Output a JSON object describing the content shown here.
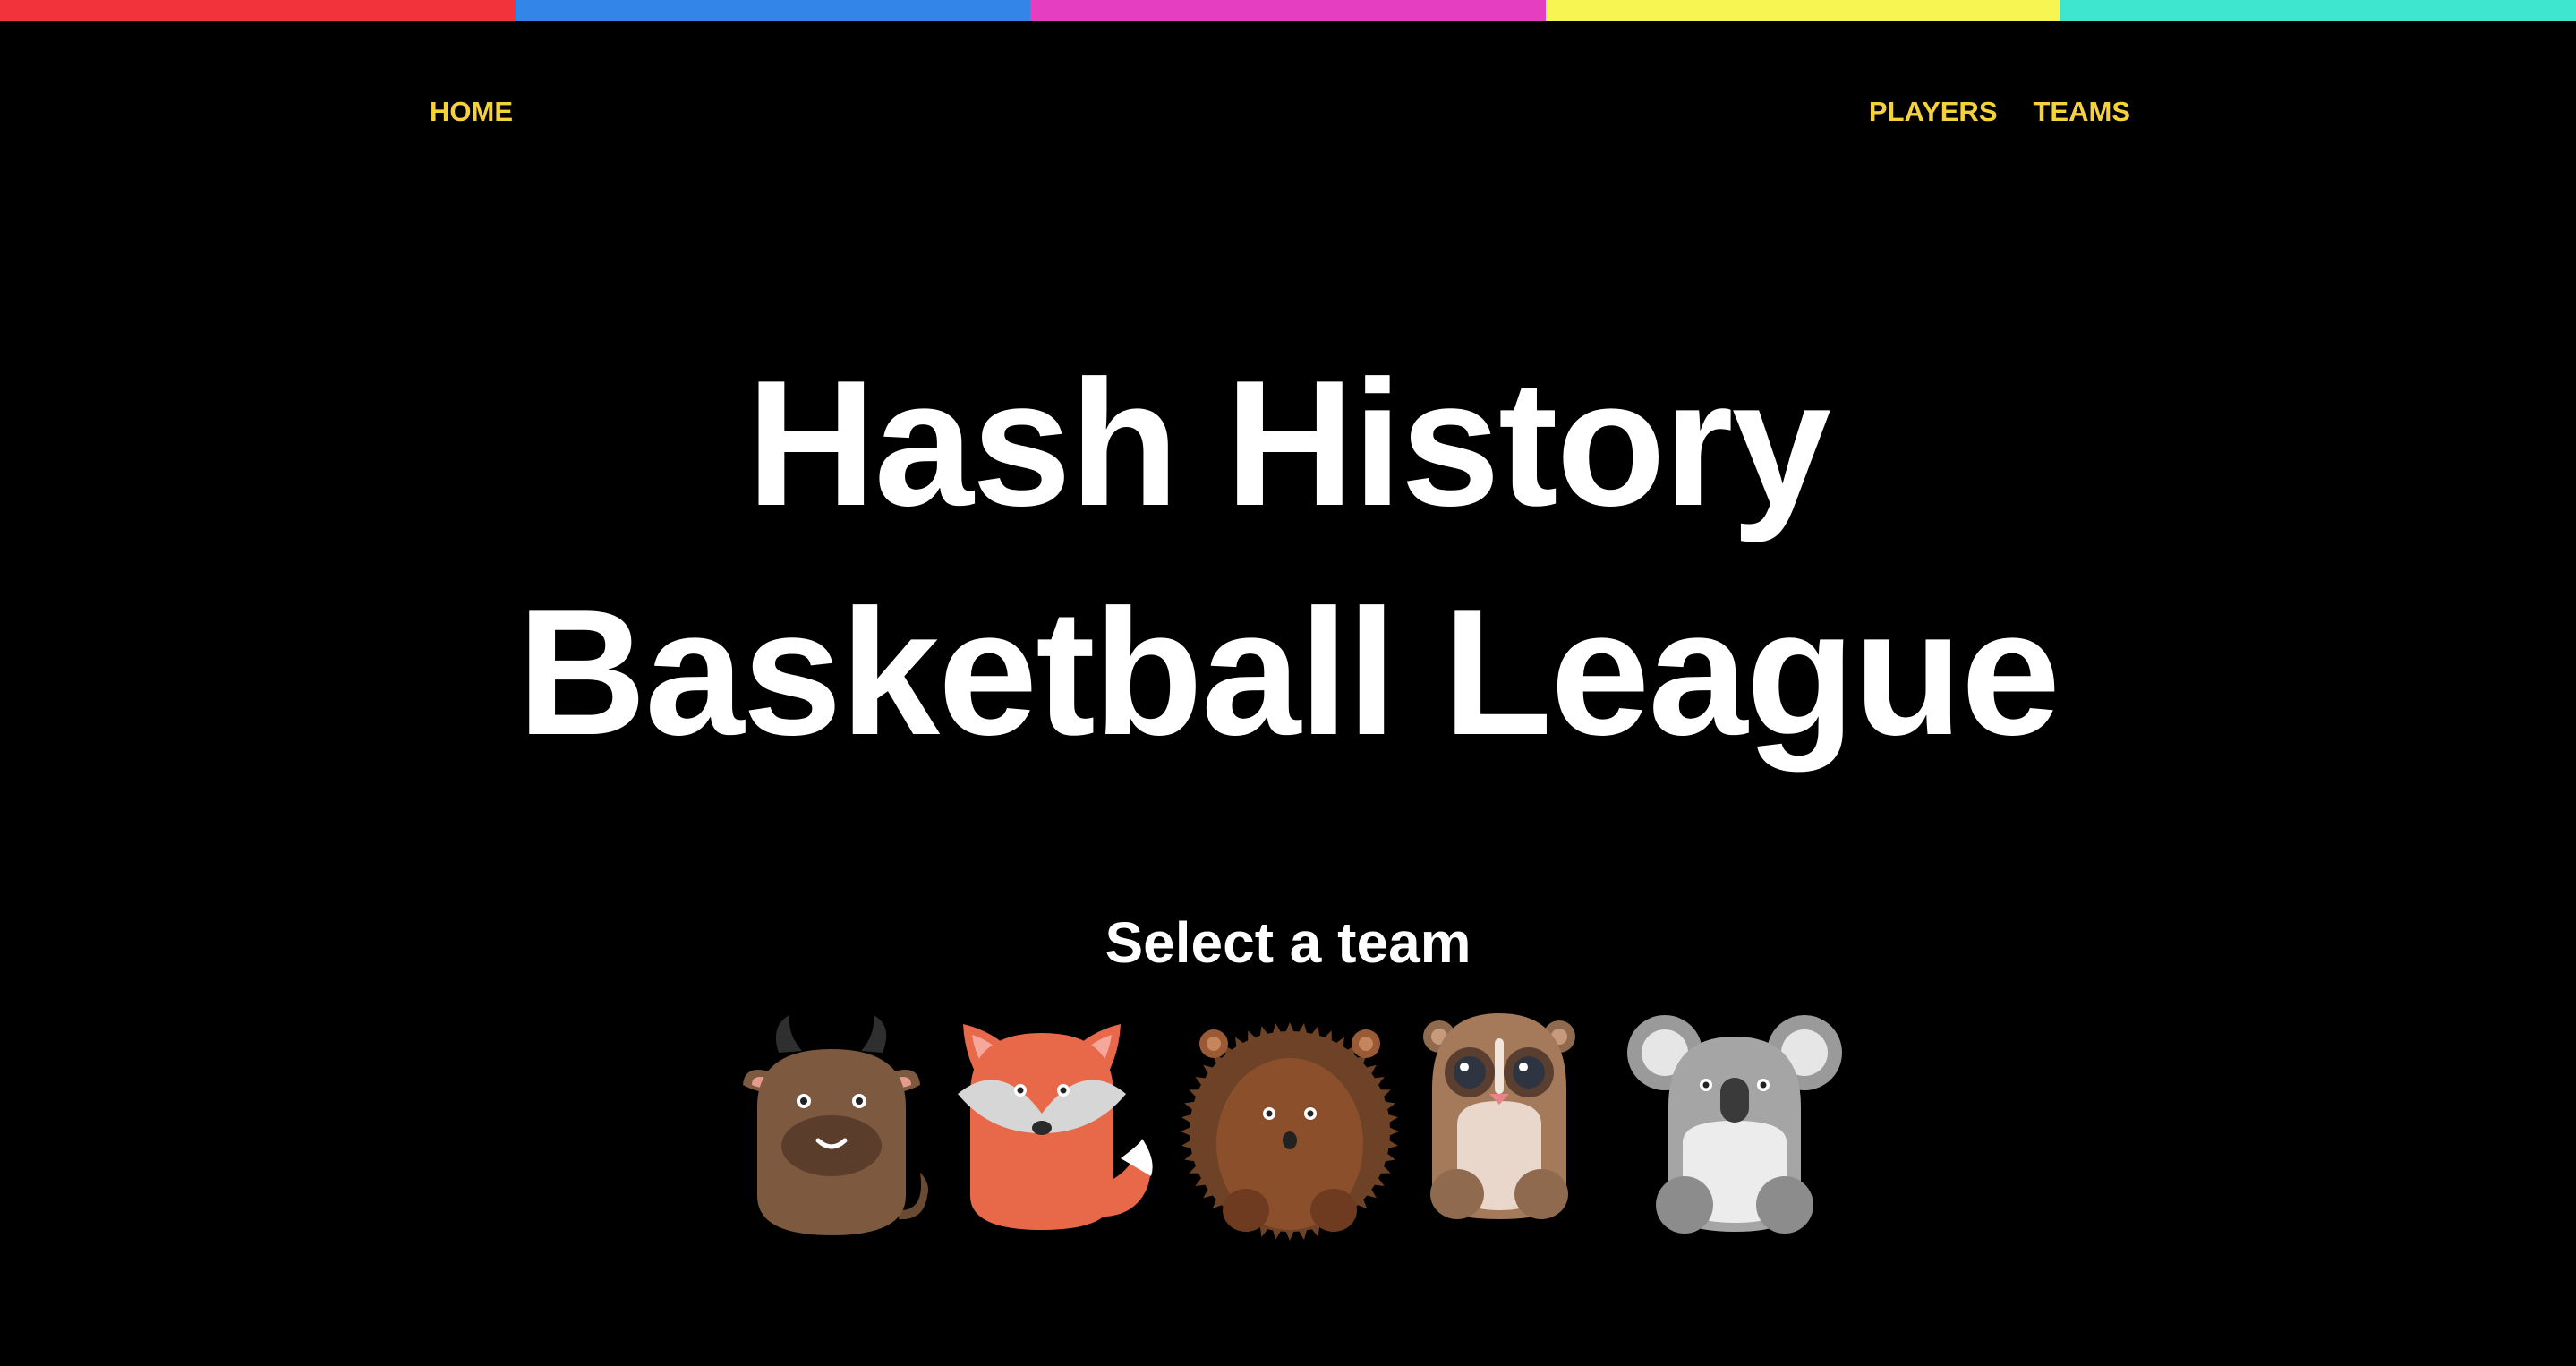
{
  "stripe_colors": [
    "#f2333b",
    "#3385e8",
    "#e63ec0",
    "#f6f552",
    "#3ee6cf"
  ],
  "nav": {
    "home_label": "HOME",
    "players_label": "PLAYERS",
    "teams_label": "TEAMS",
    "link_color": "#f6d23a"
  },
  "hero": {
    "line1": "Hash History",
    "line2": "Basketball League"
  },
  "teams_section": {
    "heading": "Select a team",
    "teams": [
      {
        "icon": "bull-icon"
      },
      {
        "icon": "fox-icon"
      },
      {
        "icon": "hedgehog-icon"
      },
      {
        "icon": "lemur-icon"
      },
      {
        "icon": "koala-icon"
      }
    ]
  }
}
